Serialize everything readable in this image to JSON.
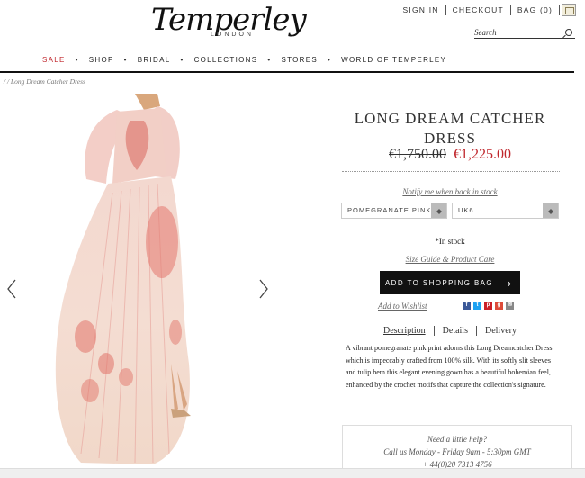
{
  "header": {
    "brand": "Temperley",
    "brand_sub": "LONDON",
    "links": {
      "sign_in": "SIGN IN",
      "checkout": "CHECKOUT",
      "bag": "BAG (0)"
    },
    "search_placeholder": "Search"
  },
  "nav": [
    "SALE",
    "SHOP",
    "BRIDAL",
    "COLLECTIONS",
    "STORES",
    "WORLD OF TEMPERLEY"
  ],
  "breadcrumb": "/   /   Long Dream Catcher Dress",
  "product": {
    "title": "LONG DREAM CATCHER DRESS",
    "old_price": "€1,750.00",
    "new_price": "€1,225.00",
    "notify": "Notify me when back in stock",
    "color_select": "POMEGRANATE PINK",
    "size_select": "UK6",
    "stock": "*In stock",
    "size_guide": "Size Guide & Product Care",
    "add_to_bag": "ADD TO SHOPPING BAG",
    "add_to_wishlist": "Add to Wishlist",
    "tabs": [
      "Description",
      "Details",
      "Delivery"
    ],
    "description": "A vibrant pomegranate pink print adorns this Long Dreamcatcher Dress which is impeccably crafted from 100% silk. With its softly slit sleeves and tulip hem this elegant evening gown has a beautiful bohemian feel, enhanced by the crochet motifs that capture the collection's signature."
  },
  "help": {
    "heading": "Need a little help?",
    "hours": "Call us Monday - Friday 9am - 5:30pm GMT",
    "phone": "+ 44(0)20 7313 4756"
  },
  "colors": {
    "accent_red": "#c0272d",
    "black": "#111111"
  },
  "social_icons": [
    "facebook-icon",
    "twitter-icon",
    "pinterest-icon",
    "google-plus-icon",
    "email-icon"
  ]
}
